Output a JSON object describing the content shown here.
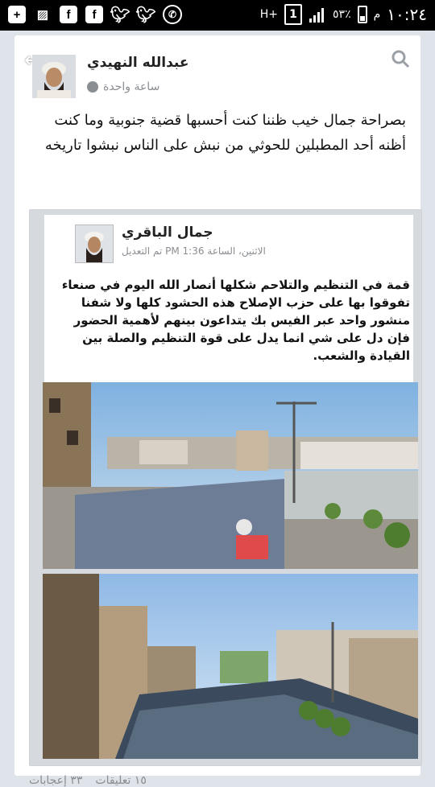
{
  "status_bar": {
    "time": "١٠:٢٤",
    "ampm": "م",
    "battery": "٥٣٪",
    "network": "H+",
    "sim": "1",
    "left_icons": [
      "add-icon",
      "no-sim-icon",
      "facebook-icon",
      "facebook-icon",
      "twitter-icon",
      "twitter-icon",
      "whatsapp-icon"
    ]
  },
  "post": {
    "author": "عبدالله النهيدي",
    "time": "ساعة واحدة",
    "text_lines": [
      "بصراحة جمال خيب ظننا كنت أحسبها قضية جنوبية وما كنت",
      "أظنه أحد المطبلين للحوثي من نبش على الناس نبشوا تاريخه"
    ]
  },
  "shared_post": {
    "author": "جمال الباقري",
    "meta": "الاثنين، الساعة 1:36 PM تم التعديل",
    "text_lines": [
      "قمة في التنظيم والتلاحم شكلها أنصار الله اليوم في صنعاء",
      "تفوقوا بها على حزب الإصلاح هذه الحشود كلها ولا شفنا",
      "منشور واحد عبر الفيس بك يتداعون بينهم لأهمية الحضور",
      "فإن دل على شي انما يدل على قوة التنظيم والصلة بين",
      "القيادة والشعب."
    ]
  },
  "footer": {
    "comments": "١٥ تعليقات",
    "likes": "٣٣ إعجابات"
  }
}
